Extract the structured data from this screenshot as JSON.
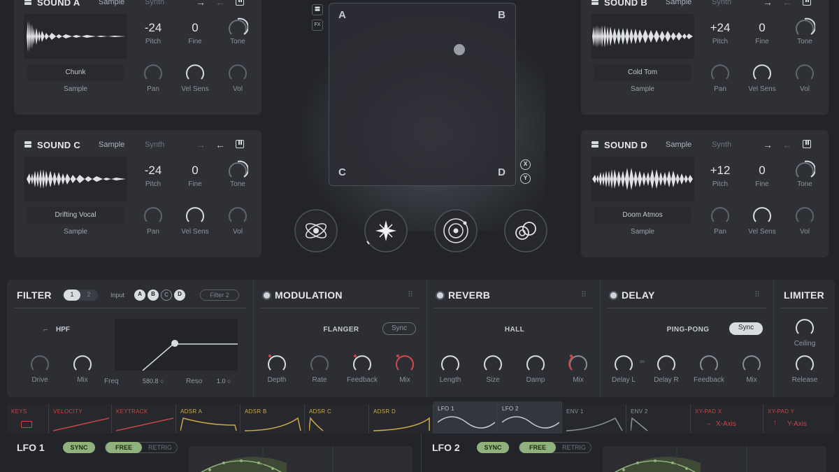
{
  "sounds": [
    {
      "id": "A",
      "title": "SOUND A",
      "tab_sample": "Sample",
      "tab_synth": "Synth",
      "name": "Chunk",
      "type": "Sample",
      "pitch": "-24",
      "fine": "0",
      "labels": {
        "pitch": "Pitch",
        "fine": "Fine",
        "tone": "Tone",
        "pan": "Pan",
        "velsens": "Vel Sens",
        "vol": "Vol"
      }
    },
    {
      "id": "B",
      "title": "SOUND B",
      "tab_sample": "Sample",
      "tab_synth": "Synth",
      "name": "Cold Tom",
      "type": "Sample",
      "pitch": "+24",
      "fine": "0",
      "labels": {
        "pitch": "Pitch",
        "fine": "Fine",
        "tone": "Tone",
        "pan": "Pan",
        "velsens": "Vel Sens",
        "vol": "Vol"
      }
    },
    {
      "id": "C",
      "title": "SOUND C",
      "tab_sample": "Sample",
      "tab_synth": "Synth",
      "name": "Drifting Vocal",
      "type": "Sample",
      "pitch": "-24",
      "fine": "0",
      "labels": {
        "pitch": "Pitch",
        "fine": "Fine",
        "tone": "Tone",
        "pan": "Pan",
        "velsens": "Vel Sens",
        "vol": "Vol"
      }
    },
    {
      "id": "D",
      "title": "SOUND D",
      "tab_sample": "Sample",
      "tab_synth": "Synth",
      "name": "Doom Atmos",
      "type": "Sample",
      "pitch": "+12",
      "fine": "0",
      "labels": {
        "pitch": "Pitch",
        "fine": "Fine",
        "tone": "Tone",
        "pan": "Pan",
        "velsens": "Vel Sens",
        "vol": "Vol"
      }
    }
  ],
  "xypad": {
    "corners": {
      "a": "A",
      "b": "B",
      "c": "C",
      "d": "D"
    },
    "axis_x": "X",
    "axis_y": "Y",
    "fx_label": "FX",
    "icons": [
      "atom-icon",
      "starburst-icon",
      "orbit-icon",
      "rings-icon"
    ]
  },
  "filter": {
    "title": "FILTER",
    "tab1": "1",
    "tab2": "2",
    "input_label": "Input",
    "inputs": [
      "A",
      "B",
      "C",
      "D"
    ],
    "filter_btn": "Filter 2",
    "type": "HPF",
    "drive": "Drive",
    "mix": "Mix",
    "freq_label": "Freq",
    "freq_value": "580.8 ○",
    "reso_label": "Reso",
    "reso_value": "1.0 ○"
  },
  "modulation": {
    "title": "MODULATION",
    "mode": "FLANGER",
    "sync": "Sync",
    "knobs": [
      "Depth",
      "Rate",
      "Feedback",
      "Mix"
    ]
  },
  "reverb": {
    "title": "REVERB",
    "mode": "HALL",
    "knobs": [
      "Length",
      "Size",
      "Damp",
      "Mix"
    ]
  },
  "delay": {
    "title": "DELAY",
    "mode": "PING-PONG",
    "sync": "Sync",
    "knobs": [
      "Delay L",
      "Delay R",
      "Feedback",
      "Mix"
    ]
  },
  "limiter": {
    "title": "LIMITER",
    "knobs": [
      "Ceiling",
      "Release"
    ]
  },
  "mod_sources": [
    "KEYS",
    "VELOCITY",
    "KEYTRACK",
    "ADSR A",
    "ADSR B",
    "ADSR C",
    "ADSR D",
    "LFO 1",
    "LFO 2",
    "ENV 1",
    "ENV 2",
    "XY-PAD X",
    "XY-PAD Y"
  ],
  "mod_sub": {
    "x": "X-Axis",
    "y": "Y-Axis"
  },
  "lfos": [
    {
      "title": "LFO 1",
      "sync": "SYNC",
      "free": "FREE",
      "retrig": "RETRIG"
    },
    {
      "title": "LFO 2",
      "sync": "SYNC",
      "free": "FREE",
      "retrig": "RETRIG"
    }
  ],
  "colors": {
    "accent_red": "#d04a4a",
    "accent_green": "#8fb27a",
    "modsource_red": "#c84646",
    "modsource_yellow": "#c9a94a"
  }
}
